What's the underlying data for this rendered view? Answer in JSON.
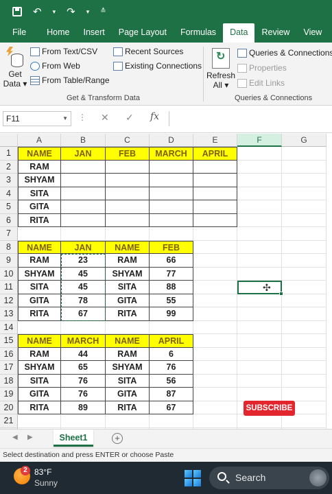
{
  "qat": {
    "save_icon": "save-icon",
    "undo_icon": "undo-icon",
    "redo_icon": "redo-icon",
    "customize_icon": "customize-icon"
  },
  "ribbon_tabs": [
    "File",
    "Home",
    "Insert",
    "Page Layout",
    "Formulas",
    "Data",
    "Review",
    "View"
  ],
  "active_tab": "Data",
  "ribbon": {
    "get_data_label": "Get",
    "get_data_label2": "Data",
    "from_text_csv": "From Text/CSV",
    "from_web": "From Web",
    "from_table_range": "From Table/Range",
    "recent_sources": "Recent Sources",
    "existing_connections": "Existing Connections",
    "group_get_transform": "Get & Transform Data",
    "refresh_label": "Refresh",
    "refresh_all": "All",
    "queries_connections": "Queries & Connections",
    "properties": "Properties",
    "edit_links": "Edit Links",
    "group_queries": "Queries & Connections"
  },
  "formula_bar": {
    "name_box": "F11",
    "cancel": "✕",
    "enter": "✓",
    "fx": "fx",
    "value": ""
  },
  "columns": [
    "A",
    "B",
    "C",
    "D",
    "E",
    "F",
    "G"
  ],
  "selected_column": "F",
  "rows": [
    [
      "NAME",
      "JAN",
      "FEB",
      "MARCH",
      "APRIL"
    ],
    [
      "RAM",
      "",
      "",
      "",
      ""
    ],
    [
      "SHYAM",
      "",
      "",
      "",
      ""
    ],
    [
      "SITA",
      "",
      "",
      "",
      ""
    ],
    [
      "GITA",
      "",
      "",
      "",
      ""
    ],
    [
      "RITA",
      "",
      "",
      "",
      ""
    ],
    [
      "",
      "",
      "",
      "",
      ""
    ],
    [
      "NAME",
      "JAN",
      "NAME",
      "FEB",
      ""
    ],
    [
      "RAM",
      "23",
      "RAM",
      "66",
      ""
    ],
    [
      "SHYAM",
      "45",
      "SHYAM",
      "77",
      ""
    ],
    [
      "SITA",
      "45",
      "SITA",
      "88",
      ""
    ],
    [
      "GITA",
      "78",
      "GITA",
      "55",
      ""
    ],
    [
      "RITA",
      "67",
      "RITA",
      "99",
      ""
    ],
    [
      "",
      "",
      "",
      "",
      ""
    ],
    [
      "NAME",
      "MARCH",
      "NAME",
      "APRIL",
      ""
    ],
    [
      "RAM",
      "44",
      "RAM",
      "6",
      ""
    ],
    [
      "SHYAM",
      "65",
      "SHYAM",
      "76",
      ""
    ],
    [
      "SITA",
      "76",
      "SITA",
      "56",
      ""
    ],
    [
      "GITA",
      "76",
      "GITA",
      "87",
      ""
    ],
    [
      "RITA",
      "89",
      "RITA",
      "67",
      ""
    ]
  ],
  "active_cell": "F11",
  "subscribe_label": "SUBSCRIBE",
  "sheet_tab": "Sheet1",
  "status_text": "Select destination and press ENTER or choose Paste",
  "taskbar": {
    "weather_badge": "2",
    "temperature": "83°F",
    "condition": "Sunny",
    "search_label": "Search"
  },
  "colors": {
    "excel_green": "#1e7145",
    "header_fill": "#ffff00",
    "subscribe": "#e3262d"
  }
}
